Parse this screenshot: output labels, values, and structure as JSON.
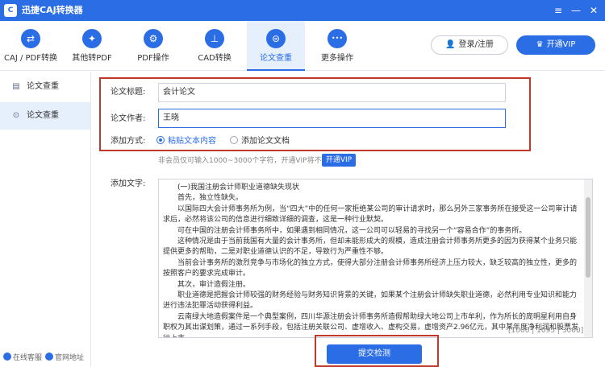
{
  "app": {
    "title": "迅捷CAJ转换器",
    "logo_text": "C"
  },
  "window": {
    "menu_glyph": "≡",
    "minimize_glyph": "—",
    "close_glyph": "✕"
  },
  "toolbar": {
    "items": [
      {
        "label": "CAJ / PDF转换",
        "icon": "swap-icon",
        "glyph": "⇄"
      },
      {
        "label": "其他转PDF",
        "icon": "pdf-icon",
        "glyph": "✦"
      },
      {
        "label": "PDF操作",
        "icon": "gear-icon",
        "glyph": "⚙"
      },
      {
        "label": "CAD转换",
        "icon": "cad-icon",
        "glyph": "⊥"
      },
      {
        "label": "论文查重",
        "icon": "paper-check-icon",
        "glyph": "⊜",
        "active": true
      },
      {
        "label": "更多操作",
        "icon": "more-icon",
        "glyph": "•••"
      }
    ],
    "login_label": "登录/注册",
    "login_glyph": "👤",
    "vip_label": "开通VIP",
    "vip_glyph": "♛"
  },
  "sidebar": {
    "items": [
      {
        "label": "论文查重",
        "icon": "document-icon",
        "glyph": "▤"
      },
      {
        "label": "论文查重",
        "icon": "search-icon",
        "glyph": "⊙",
        "active": true
      }
    ],
    "footer": {
      "service_label": "在线客服",
      "website_label": "官网地址"
    }
  },
  "form": {
    "title_label": "论文标题:",
    "title_value": "会计论文",
    "author_label": "论文作者:",
    "author_value": "王晓",
    "method_label": "添加方式:",
    "method_options": [
      "粘贴文本内容",
      "添加论文文档"
    ],
    "method_selected": "粘贴文本内容"
  },
  "notice": {
    "text": "非会员仅可输入1000~3000个字符，开通VIP将不限字数",
    "vip_button": "开通VIP"
  },
  "text_input": {
    "label": "添加文字:",
    "paragraphs": [
      "(一)我国注册会计师职业道德缺失现状",
      "首先，独立性缺失。",
      "以国际四大会计师事务所为例，当“四大”中的任何一家拒绝某公司的审计请求时，那么另外三家事务所在接受这一公司审计请求后，必然将该公司的信息进行细致详细的调查，这是一种行业默契。",
      "可在中国的注册会计师事务所中，如果遇到相同情况，这一公司可以轻易的寻找另一个“容易合作”的事务所。",
      "这种情况是由于当前我国有大量的会计事务所，但却未能形成大的规模，造成注册会计师事务所更多的因为获得某个业务只能提供更多的帮助，二是对职业道德认识的不足，导致行为严重性不够。",
      "当前会计事务所的激烈竞争与市场化的独立方式，使得大部分注册会计师事务所经济上压力较大，缺乏较高的独立性，更多的按照客户的要求完成审计。",
      "其次，审计造假注册。",
      "职业道德是把握会计师较强的财务经验与财务知识背景的关键，如果某个注册会计师缺失职业道德，必然利用专业知识和能力进行违法犯罪活动获得利益。",
      "云南绿大地造假案件是一个典型案例，四川华源注册会计师事务所造假帮助绿大地公司上市牟利，作为所长的庞明星利用自身职权为其出谋划策，通过一系列手段，包括注册关联公司、虚增收入、虚构交易，虚增资产2.96亿元，其中某年度净利润和股票发行上市"
    ],
    "counter": "[1000 | 1095 | 3000]"
  },
  "actions": {
    "submit_label": "提交检测"
  }
}
